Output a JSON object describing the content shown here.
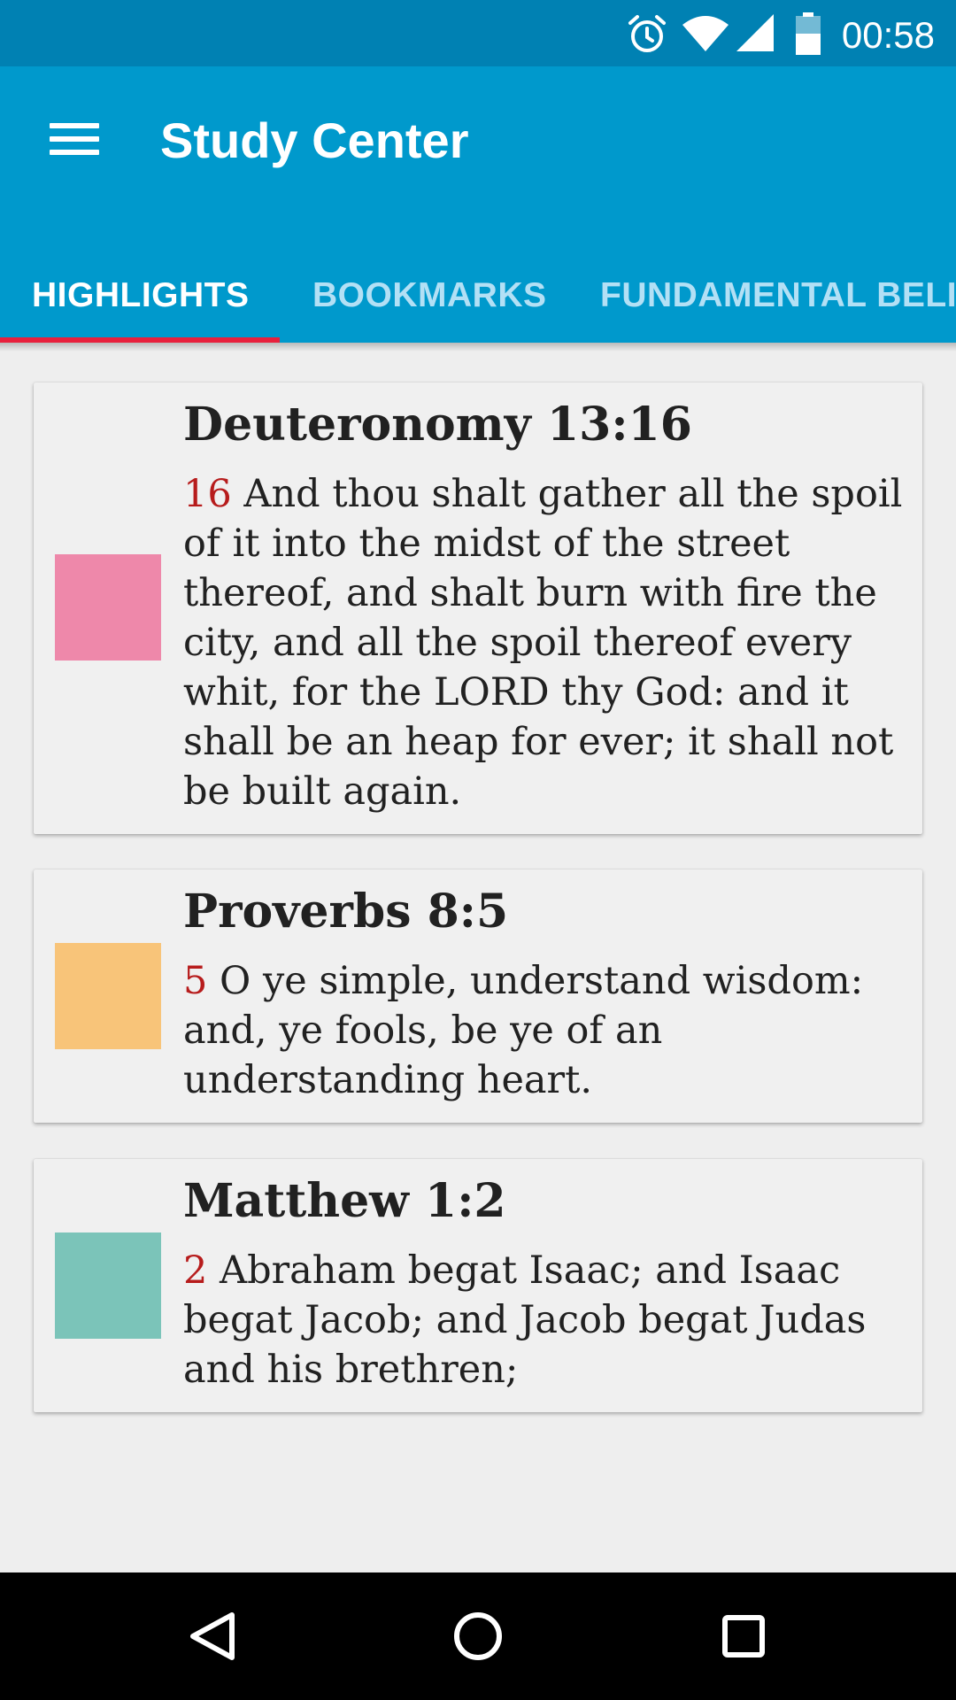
{
  "status_bar": {
    "time": "00:58",
    "icons": [
      "alarm-icon",
      "wifi-icon",
      "signal-icon",
      "battery-icon"
    ]
  },
  "app_bar": {
    "title": "Study Center",
    "menu_icon": "hamburger-menu-icon",
    "color": "#0099cc"
  },
  "tabs": [
    {
      "label": "HIGHLIGHTS",
      "active": true
    },
    {
      "label": "BOOKMARKS",
      "active": false
    },
    {
      "label": "FUNDAMENTAL BELI",
      "active": false
    }
  ],
  "highlights": [
    {
      "reference": "Deuteronomy 13:16",
      "verse_number": "16",
      "text": "And thou shalt gather all the spoil of it into the midst of the street thereof, and shalt burn with fire the city, and all the spoil thereof every whit, for the LORD thy God: and it shall be an heap for ever; it shall not be built again.",
      "color": "#ee88aa"
    },
    {
      "reference": "Proverbs 8:5",
      "verse_number": "5",
      "text": "O ye simple, understand wisdom: and, ye fools, be ye of an understanding heart.",
      "color": "#f8c479"
    },
    {
      "reference": "Matthew 1:2",
      "verse_number": "2",
      "text": "Abraham begat Isaac; and Isaac begat Jacob; and Jacob begat Judas and his brethren;",
      "color": "#7bc4b9"
    }
  ],
  "colors": {
    "tab_indicator": "#e8203c",
    "verse_number": "#b71c1c"
  },
  "nav_bar": {
    "icons": [
      "back-icon",
      "home-icon",
      "recents-icon"
    ]
  }
}
